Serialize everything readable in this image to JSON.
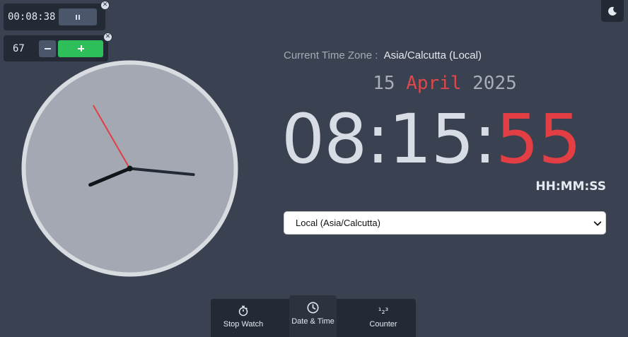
{
  "stopwatch": {
    "elapsed": "00:08:38",
    "state": "running"
  },
  "counter": {
    "value": "67"
  },
  "timezone": {
    "label": "Current Time Zone :",
    "value": "Asia/Calcutta (Local)"
  },
  "date": {
    "day": "15",
    "month": "April",
    "year": "2025"
  },
  "time": {
    "hours": "08",
    "minutes": "15",
    "seconds": "55",
    "separator": ":",
    "format": "HH:MM:SS"
  },
  "timezone_select": {
    "selected": "Local (Asia/Calcutta)"
  },
  "nav": {
    "items": [
      {
        "label": "Stop Watch",
        "icon": "stopwatch-icon"
      },
      {
        "label": "Date & Time",
        "icon": "clock-icon",
        "active": true
      },
      {
        "label": "Counter",
        "icon": "counter-icon"
      }
    ]
  },
  "colors": {
    "background": "#3a4150",
    "panel": "#232a35",
    "accent_red": "#e23e44",
    "accent_green": "#2fbf5a",
    "clock_face": "#a3a8b3",
    "clock_rim": "#d8dbe0"
  }
}
